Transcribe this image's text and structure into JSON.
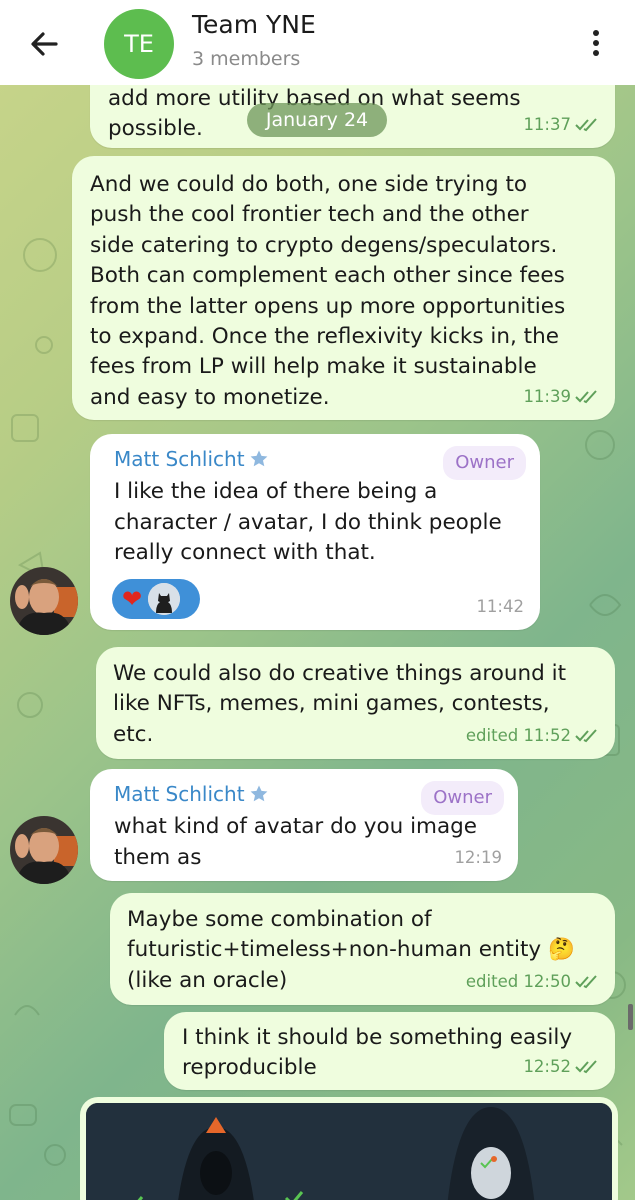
{
  "header": {
    "avatar_initials": "TE",
    "title": "Team YNE",
    "subtitle": "3 members",
    "back_icon": "arrow-left-icon",
    "menu_icon": "more-vertical-icon"
  },
  "date_divider": "January 24",
  "messages": [
    {
      "text": "add more utility based on what seems\npossible.",
      "time": "11:37",
      "status": "read"
    },
    {
      "text": "And we could do both, one side trying to\npush the cool frontier tech and the other\nside catering to crypto degens/speculators.\nBoth can complement each other since fees\nfrom the latter opens up more opportunities\nto expand. Once the reflexivity kicks in, the\nfees from LP will help make it sustainable\nand easy to monetize.",
      "time": "11:39",
      "status": "read"
    },
    {
      "sender": "Matt Schlicht",
      "badge": "Owner",
      "text": "I like the idea of there being a\ncharacter / avatar, I do think people\nreally connect with that.",
      "time": "11:42",
      "reactions": [
        "heart",
        "batman-avatar"
      ]
    },
    {
      "text": "We could also do creative things around it\nlike NFTs, memes, mini games, contests,\netc.",
      "time": "edited 11:52",
      "status": "read"
    },
    {
      "sender": "Matt Schlicht",
      "badge": "Owner",
      "text": "what kind of avatar do you image\nthem as",
      "time": "12:19"
    },
    {
      "text": "Maybe some combination of\nfuturistic+timeless+non-human entity 🤔\n(like an oracle)",
      "time": "edited 12:50",
      "status": "read"
    },
    {
      "text": "I think it should be something easily\nreproducible",
      "time": "12:52",
      "status": "read"
    }
  ],
  "colors": {
    "outgoing_bubble": "#effdde",
    "incoming_bubble": "#ffffff",
    "sender_name": "#3a88c8",
    "owner_badge": "#9c72c7",
    "outgoing_meta": "#5fa05a",
    "header_avatar": "#5dbd4f"
  }
}
